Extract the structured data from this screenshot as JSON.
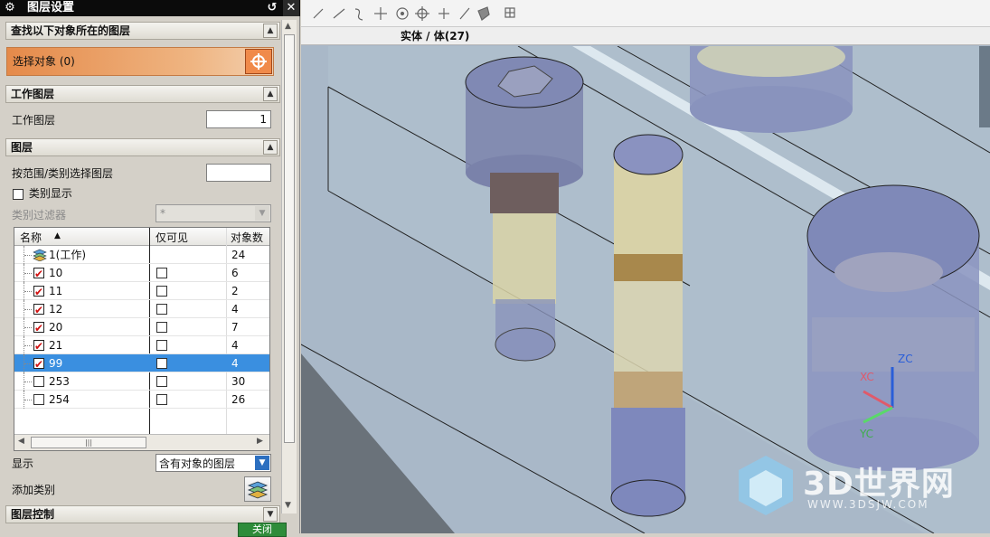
{
  "dialog": {
    "title": "图层设置",
    "close_glyph": "✕",
    "reset_glyph": "↺"
  },
  "find_section": {
    "header": "查找以下对象所在的图层",
    "select_label": "选择对象 (0)"
  },
  "work_layer_section": {
    "header": "工作图层",
    "label": "工作图层",
    "value": "1"
  },
  "layer_section": {
    "header": "图层",
    "range_label": "按范围/类别选择图层",
    "range_value": "",
    "category_display_label": "类别显示",
    "category_display_checked": false,
    "category_filter_label": "类别过滤器",
    "category_filter_value": "*",
    "columns": {
      "name": "名称",
      "visible_only": "仅可见",
      "count": "对象数"
    },
    "rows": [
      {
        "name": "1(工作)",
        "checked": null,
        "visible_only": null,
        "count": "24",
        "selected": false
      },
      {
        "name": "10",
        "checked": true,
        "visible_only": false,
        "count": "6",
        "selected": false
      },
      {
        "name": "11",
        "checked": true,
        "visible_only": false,
        "count": "2",
        "selected": false
      },
      {
        "name": "12",
        "checked": true,
        "visible_only": false,
        "count": "4",
        "selected": false
      },
      {
        "name": "20",
        "checked": true,
        "visible_only": false,
        "count": "7",
        "selected": false
      },
      {
        "name": "21",
        "checked": true,
        "visible_only": false,
        "count": "4",
        "selected": false
      },
      {
        "name": "99",
        "checked": true,
        "visible_only": false,
        "count": "4",
        "selected": true
      },
      {
        "name": "253",
        "checked": false,
        "visible_only": false,
        "count": "30",
        "selected": false
      },
      {
        "name": "254",
        "checked": false,
        "visible_only": false,
        "count": "26",
        "selected": false
      }
    ],
    "display_label": "显示",
    "display_value": "含有对象的图层",
    "add_category_label": "添加类别"
  },
  "layer_control_section": {
    "header": "图层控制"
  },
  "close_button": "关闭",
  "viewport": {
    "title": "实体 / 体(27)",
    "axes": {
      "z": "ZC",
      "x": "XC",
      "y": "YC"
    },
    "watermark_main": "3D世界网",
    "watermark_sub": "WWW.3DSJW.COM"
  },
  "colors": {
    "accent_orange": "#f08a4a",
    "selection_blue": "#3a8fe0",
    "titlebar": "#0b0b0b"
  }
}
